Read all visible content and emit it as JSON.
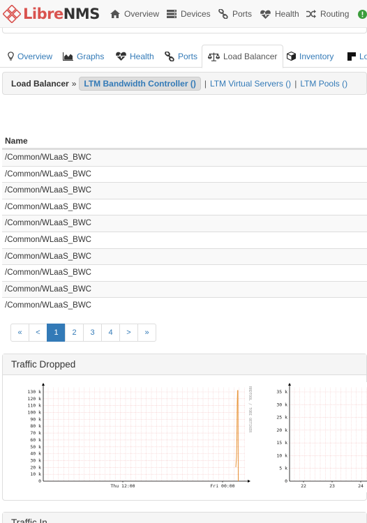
{
  "brand": {
    "libre": "Libre",
    "nms": "NMS"
  },
  "navbar": {
    "items": [
      {
        "label": "Overview",
        "icon": "home-icon"
      },
      {
        "label": "Devices",
        "icon": "server-icon"
      },
      {
        "label": "Ports",
        "icon": "link-icon"
      },
      {
        "label": "Health",
        "icon": "heartbeat-icon"
      },
      {
        "label": "Routing",
        "icon": "random-icon"
      }
    ]
  },
  "tabs": [
    {
      "label": "Overview",
      "icon": "lightbulb-icon",
      "active": false
    },
    {
      "label": "Graphs",
      "icon": "area-chart-icon",
      "active": false
    },
    {
      "label": "Health",
      "icon": "heartbeat-icon",
      "active": false
    },
    {
      "label": "Ports",
      "icon": "link-icon",
      "active": false
    },
    {
      "label": "Load Balancer",
      "icon": "balance-scale-icon",
      "active": true
    },
    {
      "label": "Inventory",
      "icon": "cube-icon",
      "active": false
    },
    {
      "label": "Lo",
      "icon": "square-icon",
      "active": false
    }
  ],
  "breadcrumb": {
    "title": "Load Balancer",
    "separator": "»",
    "active": "LTM Bandwidth Controller ()",
    "links": [
      "LTM Virtual Servers ()",
      "LTM Pools ()"
    ],
    "pipe": "|"
  },
  "table": {
    "header": "Name",
    "rows": [
      "/Common/WLaaS_BWC",
      "/Common/WLaaS_BWC",
      "/Common/WLaaS_BWC",
      "/Common/WLaaS_BWC",
      "/Common/WLaaS_BWC",
      "/Common/WLaaS_BWC",
      "/Common/WLaaS_BWC",
      "/Common/WLaaS_BWC",
      "/Common/WLaaS_BWC",
      "/Common/WLaaS_BWC"
    ]
  },
  "pagination": [
    "«",
    "<",
    "1",
    "2",
    "3",
    "4",
    ">",
    "»"
  ],
  "pagination_active": "1",
  "panels": [
    {
      "title": "Traffic Dropped"
    },
    {
      "title": "Traffic In"
    }
  ],
  "graph_left": {
    "y_ticks": [
      "130 k",
      "120 k",
      "110 k",
      "100 k",
      "90 k",
      "80 k",
      "70 k",
      "60 k",
      "50 k",
      "40 k",
      "30 k",
      "20 k",
      "10 k",
      "0"
    ],
    "x_ticks": [
      "Thu 12:00",
      "Fri 00:00"
    ],
    "side_label": "RRDTOOL / TOBI OETIKER"
  },
  "graph_right": {
    "y_ticks": [
      "35 k",
      "30 k",
      "25 k",
      "20 k",
      "15 k",
      "10 k",
      "5 k",
      "0"
    ],
    "x_ticks": [
      "22",
      "23",
      "24"
    ]
  },
  "colors": {
    "accent": "#337ab7",
    "series": "#e8953a",
    "grid": "#f4c3c3",
    "brand": "#d9534f"
  }
}
